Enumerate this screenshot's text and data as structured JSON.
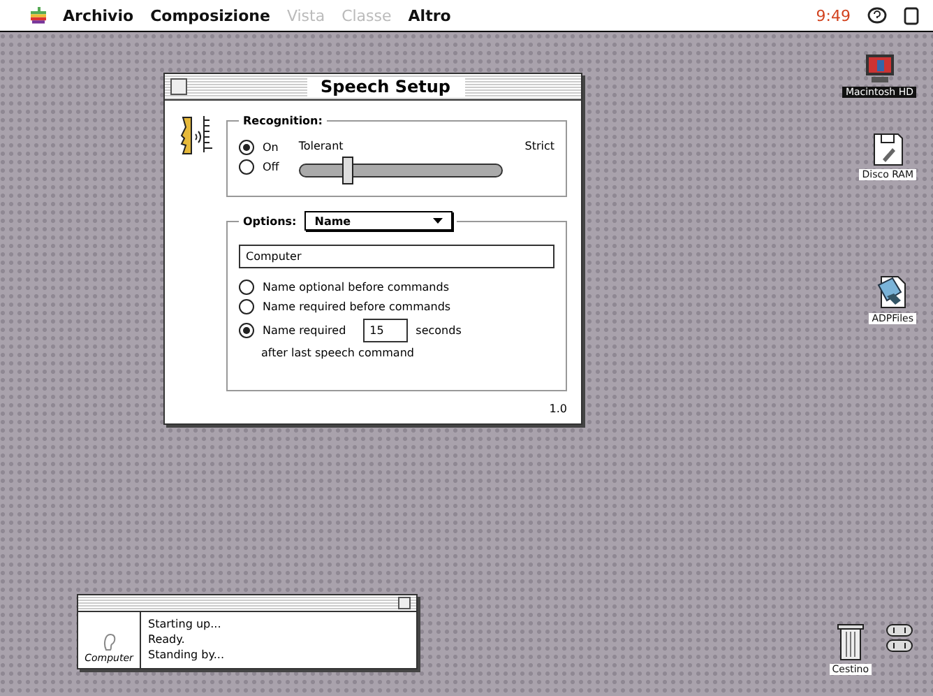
{
  "menu_bar": {
    "items": [
      {
        "label": "Archivio",
        "disabled": false
      },
      {
        "label": "Composizione",
        "disabled": false
      },
      {
        "label": "Vista",
        "disabled": true
      },
      {
        "label": "Classe",
        "disabled": true
      },
      {
        "label": "Altro",
        "disabled": false
      }
    ],
    "clock": "9:49"
  },
  "speech_setup": {
    "title": "Speech Setup",
    "recognition": {
      "label": "Recognition:",
      "modes": [
        {
          "label": "On",
          "selected": true
        },
        {
          "label": "Off",
          "selected": false
        }
      ],
      "tolerance": {
        "min_label": "Tolerant",
        "max_label": "Strict",
        "level": 0.24
      }
    },
    "options": {
      "label": "Options:",
      "menu": "Name",
      "name_value": "Computer",
      "choices": [
        {
          "label": "Name optional before commands",
          "selected": false,
          "kind": "plain"
        },
        {
          "label": "Name required before commands",
          "selected": false,
          "kind": "plain"
        },
        {
          "label": "Name required",
          "selected": true,
          "kind": "timed",
          "seconds": "15",
          "unit": "seconds",
          "note": "after last speech command"
        }
      ]
    },
    "version": "1.0"
  },
  "feedback": {
    "name": "Computer",
    "lines": [
      "Starting up...",
      "Ready.",
      "Standing by..."
    ]
  },
  "desktop_icons": [
    {
      "label": "Macintosh HD",
      "kind": "disk",
      "selected": true
    },
    {
      "label": "Disco RAM",
      "kind": "ram",
      "selected": false
    },
    {
      "label": "ADPFiles",
      "kind": "file",
      "selected": false
    },
    {
      "label": "Cestino",
      "kind": "trash",
      "selected": false
    }
  ]
}
